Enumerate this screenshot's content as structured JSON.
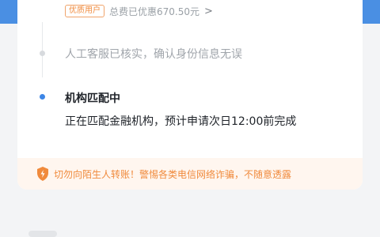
{
  "header": {
    "badge": "优质用户",
    "saved": "总费已优惠670.50元",
    "chevron": ">"
  },
  "timeline": [
    {
      "label": "人工客服已核实，确认身份信息无误",
      "status": "done"
    },
    {
      "title": "机构匹配中",
      "desc": "正在匹配金融机构，预计申请次日12:00前完成",
      "status": "active"
    }
  ],
  "warning": {
    "text": "切勿向陌生人转账！警惕各类电信网络诈骗，不随意透露",
    "icon": "shield-alert-icon",
    "color": "#f08a3c"
  },
  "colors": {
    "accent": "#3d86e6",
    "warning": "#f08a3c"
  }
}
